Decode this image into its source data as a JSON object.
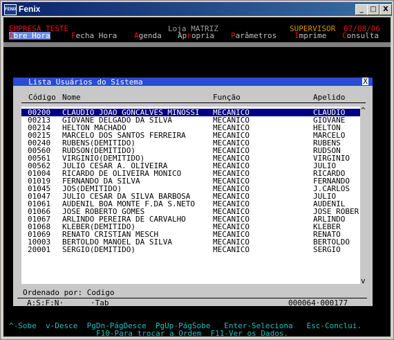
{
  "window": {
    "title": "Fenix",
    "icon_label": "FENIX",
    "minimize": "_",
    "maximize": "□",
    "close": "X"
  },
  "header": {
    "company": "EMPRESA TESTE",
    "store": "Loja MATRIZ",
    "role": "SUPERVISOR",
    "date": "07/08/06"
  },
  "menu": [
    {
      "hotkey": "A",
      "rest": "bre Hora",
      "selected": true
    },
    {
      "hotkey": "F",
      "rest": "echa Hora",
      "selected": false
    },
    {
      "hotkey": "A",
      "rest": "genda",
      "selected": false
    },
    {
      "pre": "Ap",
      "hotkey": "r",
      "rest": "opria",
      "selected": false
    },
    {
      "hotkey": "P",
      "rest": "arâmetros",
      "selected": false
    },
    {
      "hotkey": "I",
      "rest": "mprime",
      "selected": false
    },
    {
      "hotkey": "C",
      "rest": "onsulta",
      "selected": false
    }
  ],
  "dialog": {
    "title": "Lista Usuários do Sistema",
    "close": "X",
    "columns": {
      "code": "Código",
      "name": "Nome",
      "role": "Função",
      "nick": "Apelido"
    },
    "rows": [
      {
        "code": "00200",
        "name": "CLAUDIO JOAO GONCALVES MINOSSI",
        "role": "MECANICO",
        "nick": "CLAUDIO",
        "selected": true
      },
      {
        "code": "00213",
        "name": "GIOVANE DELGADO DA SILVA",
        "role": "MECANICO",
        "nick": "GIOVANE"
      },
      {
        "code": "00214",
        "name": "HELTON MACHADO",
        "role": "MECANICO",
        "nick": "HELTON"
      },
      {
        "code": "00215",
        "name": "MARCELO DOS SANTOS FERREIRA",
        "role": "MECANICO",
        "nick": "MARCELO"
      },
      {
        "code": "00240",
        "name": "RUBENS(DEMITIDO)",
        "role": "MECANICO",
        "nick": "RUBENS"
      },
      {
        "code": "00560",
        "name": "RUDSON(DEMITIDO)",
        "role": "MECANICO",
        "nick": "RUDSON"
      },
      {
        "code": "00561",
        "name": "VIRGINIO(DEMITIDO)",
        "role": "MECANICO",
        "nick": "VIRGINIO"
      },
      {
        "code": "00562",
        "name": "JULIO CESAR A. OLIVEIRA",
        "role": "MECANICO",
        "nick": "JULIO"
      },
      {
        "code": "01004",
        "name": "RICARDO DE OLIVEIRA MONICO",
        "role": "MECANICO",
        "nick": "RICARDO"
      },
      {
        "code": "01019",
        "name": "FERNANDO DA SILVA",
        "role": "MECANICO",
        "nick": "FERNANDO"
      },
      {
        "code": "01045",
        "name": "JOS(DEMITIDO)",
        "role": "MECANICO",
        "nick": "J.CARLOS"
      },
      {
        "code": "01047",
        "name": "JULIO CESAR DA SILVA BARBOSA",
        "role": "MECANICO",
        "nick": "JULIO"
      },
      {
        "code": "01061",
        "name": "AUDENIL BOA MONTE F.DA S.NETO",
        "role": "MECANICO",
        "nick": "AUDENIL"
      },
      {
        "code": "01066",
        "name": "JOSE ROBERTO GOMES",
        "role": "MECANICO",
        "nick": "JOSE ROBER"
      },
      {
        "code": "01067",
        "name": "ARLINDO PEREIRA DE CARVALHO",
        "role": "MECANICO",
        "nick": "ARLINDO"
      },
      {
        "code": "01068",
        "name": "KLEBER(DEMITIDO)",
        "role": "MECANICO",
        "nick": "KLEBER"
      },
      {
        "code": "01069",
        "name": "RENATO CRISTIAN MESCH",
        "role": "MECANICO",
        "nick": "RENATO"
      },
      {
        "code": "10003",
        "name": "BERTOLDO MANOEL DA SILVA",
        "role": "MECANICO",
        "nick": "BERTOLDO"
      },
      {
        "code": "20001",
        "name": "SERGIO(DEMITIDO)",
        "role": "MECANICO",
        "nick": "SERGIO"
      }
    ],
    "scroll_up": "^",
    "scroll_down": "v",
    "order_label": "Ordenado por: Codigo",
    "status_left": "A:S:F:N·",
    "status_tab": "·Tab",
    "status_count": "000064·000177"
  },
  "help": {
    "line1": "^-Sobe  v-Desce  PgDn-PágDesce  PgUp-PágSobe   Enter-Seleciona   Esc-Conclui.",
    "line2": "F10-Para trocar a Ordem  F11-Ver os Dados."
  }
}
